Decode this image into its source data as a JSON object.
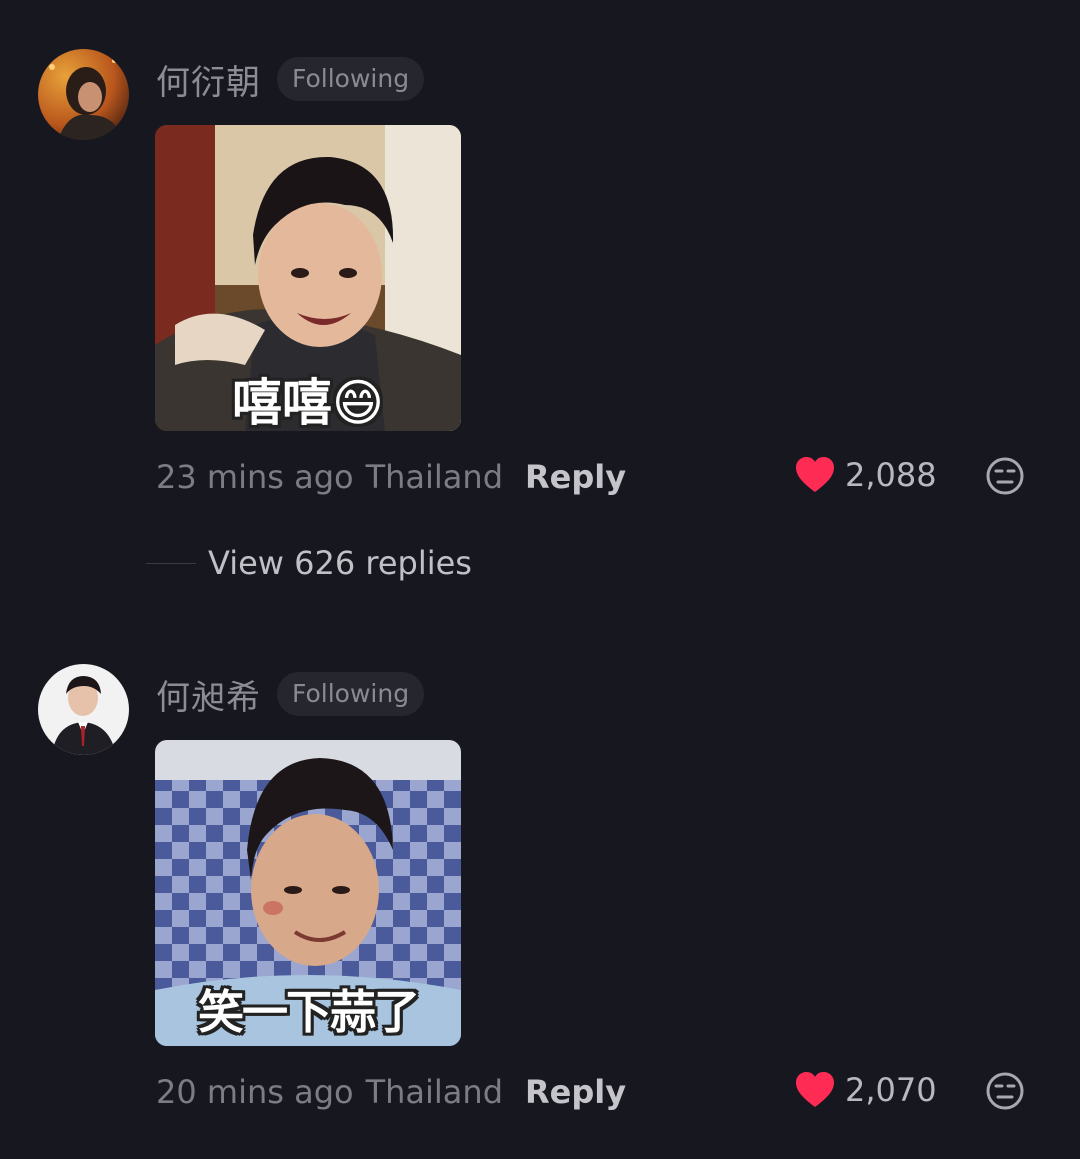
{
  "comments": [
    {
      "username": "何衍朝",
      "badge": "Following",
      "sticker_caption": "嘻嘻😄",
      "time": "23 mins ago",
      "location": "Thailand",
      "reply_label": "Reply",
      "likes": "2,088",
      "view_replies": "View 626 replies"
    },
    {
      "username": "何昶希",
      "badge": "Following",
      "sticker_caption": "笑一下蒜了",
      "time": "20 mins ago",
      "location": "Thailand",
      "reply_label": "Reply",
      "likes": "2,070"
    }
  ],
  "icons": {
    "like": "heart-icon",
    "dislike": "unamused-face-icon"
  },
  "colors": {
    "background": "#17171f",
    "like_heart": "#fe2c55",
    "badge_bg": "#26262e"
  }
}
